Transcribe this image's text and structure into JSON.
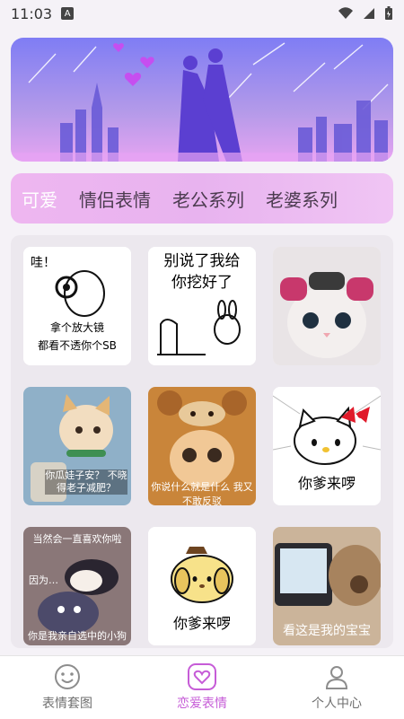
{
  "status_bar": {
    "time": "11:03",
    "notification_badge": "A"
  },
  "tabs": [
    {
      "label": "可爱",
      "active": true
    },
    {
      "label": "情侣表情",
      "active": false
    },
    {
      "label": "老公系列",
      "active": false
    },
    {
      "label": "老婆系列",
      "active": false
    }
  ],
  "stickers": [
    {
      "caption_top": "哇！",
      "caption_mid": "拿个放大镜",
      "caption_bottom": "都看不透你个SB",
      "icon": "rabbit-magnifier-icon"
    },
    {
      "caption_top": "别说了我给",
      "caption_mid": "你挖好了",
      "icon": "grave-rabbit-icon"
    },
    {
      "icon": "cat-with-curlers-icon"
    },
    {
      "icon": "cat-with-collar-icon",
      "caption": "你瓜娃子安？ 不晓得老子减肥？"
    },
    {
      "icon": "cat-in-bear-hood-icon",
      "caption": "你说什么就是什么 我又不敢反驳"
    },
    {
      "icon": "hello-kitty-icon",
      "caption": "你爹来啰"
    },
    {
      "icon": "kuromi-icon",
      "caption_top": "当然会一直喜欢你啦",
      "caption_mid": "因为…",
      "caption_bottom": "你是我亲自选中的小狗"
    },
    {
      "icon": "pompompurin-icon",
      "caption": "你爹来啰"
    },
    {
      "icon": "teddy-bear-camera-icon",
      "caption": "看这是我的宝宝"
    }
  ],
  "bottom_nav": [
    {
      "label": "表情套图",
      "icon": "smiley-icon",
      "active": false
    },
    {
      "label": "恋爱表情",
      "icon": "heart-icon",
      "active": true
    },
    {
      "label": "个人中心",
      "icon": "person-icon",
      "active": false
    }
  ],
  "colors": {
    "accent": "#c65cd7",
    "tabs_bg": "#eeb6f0"
  }
}
